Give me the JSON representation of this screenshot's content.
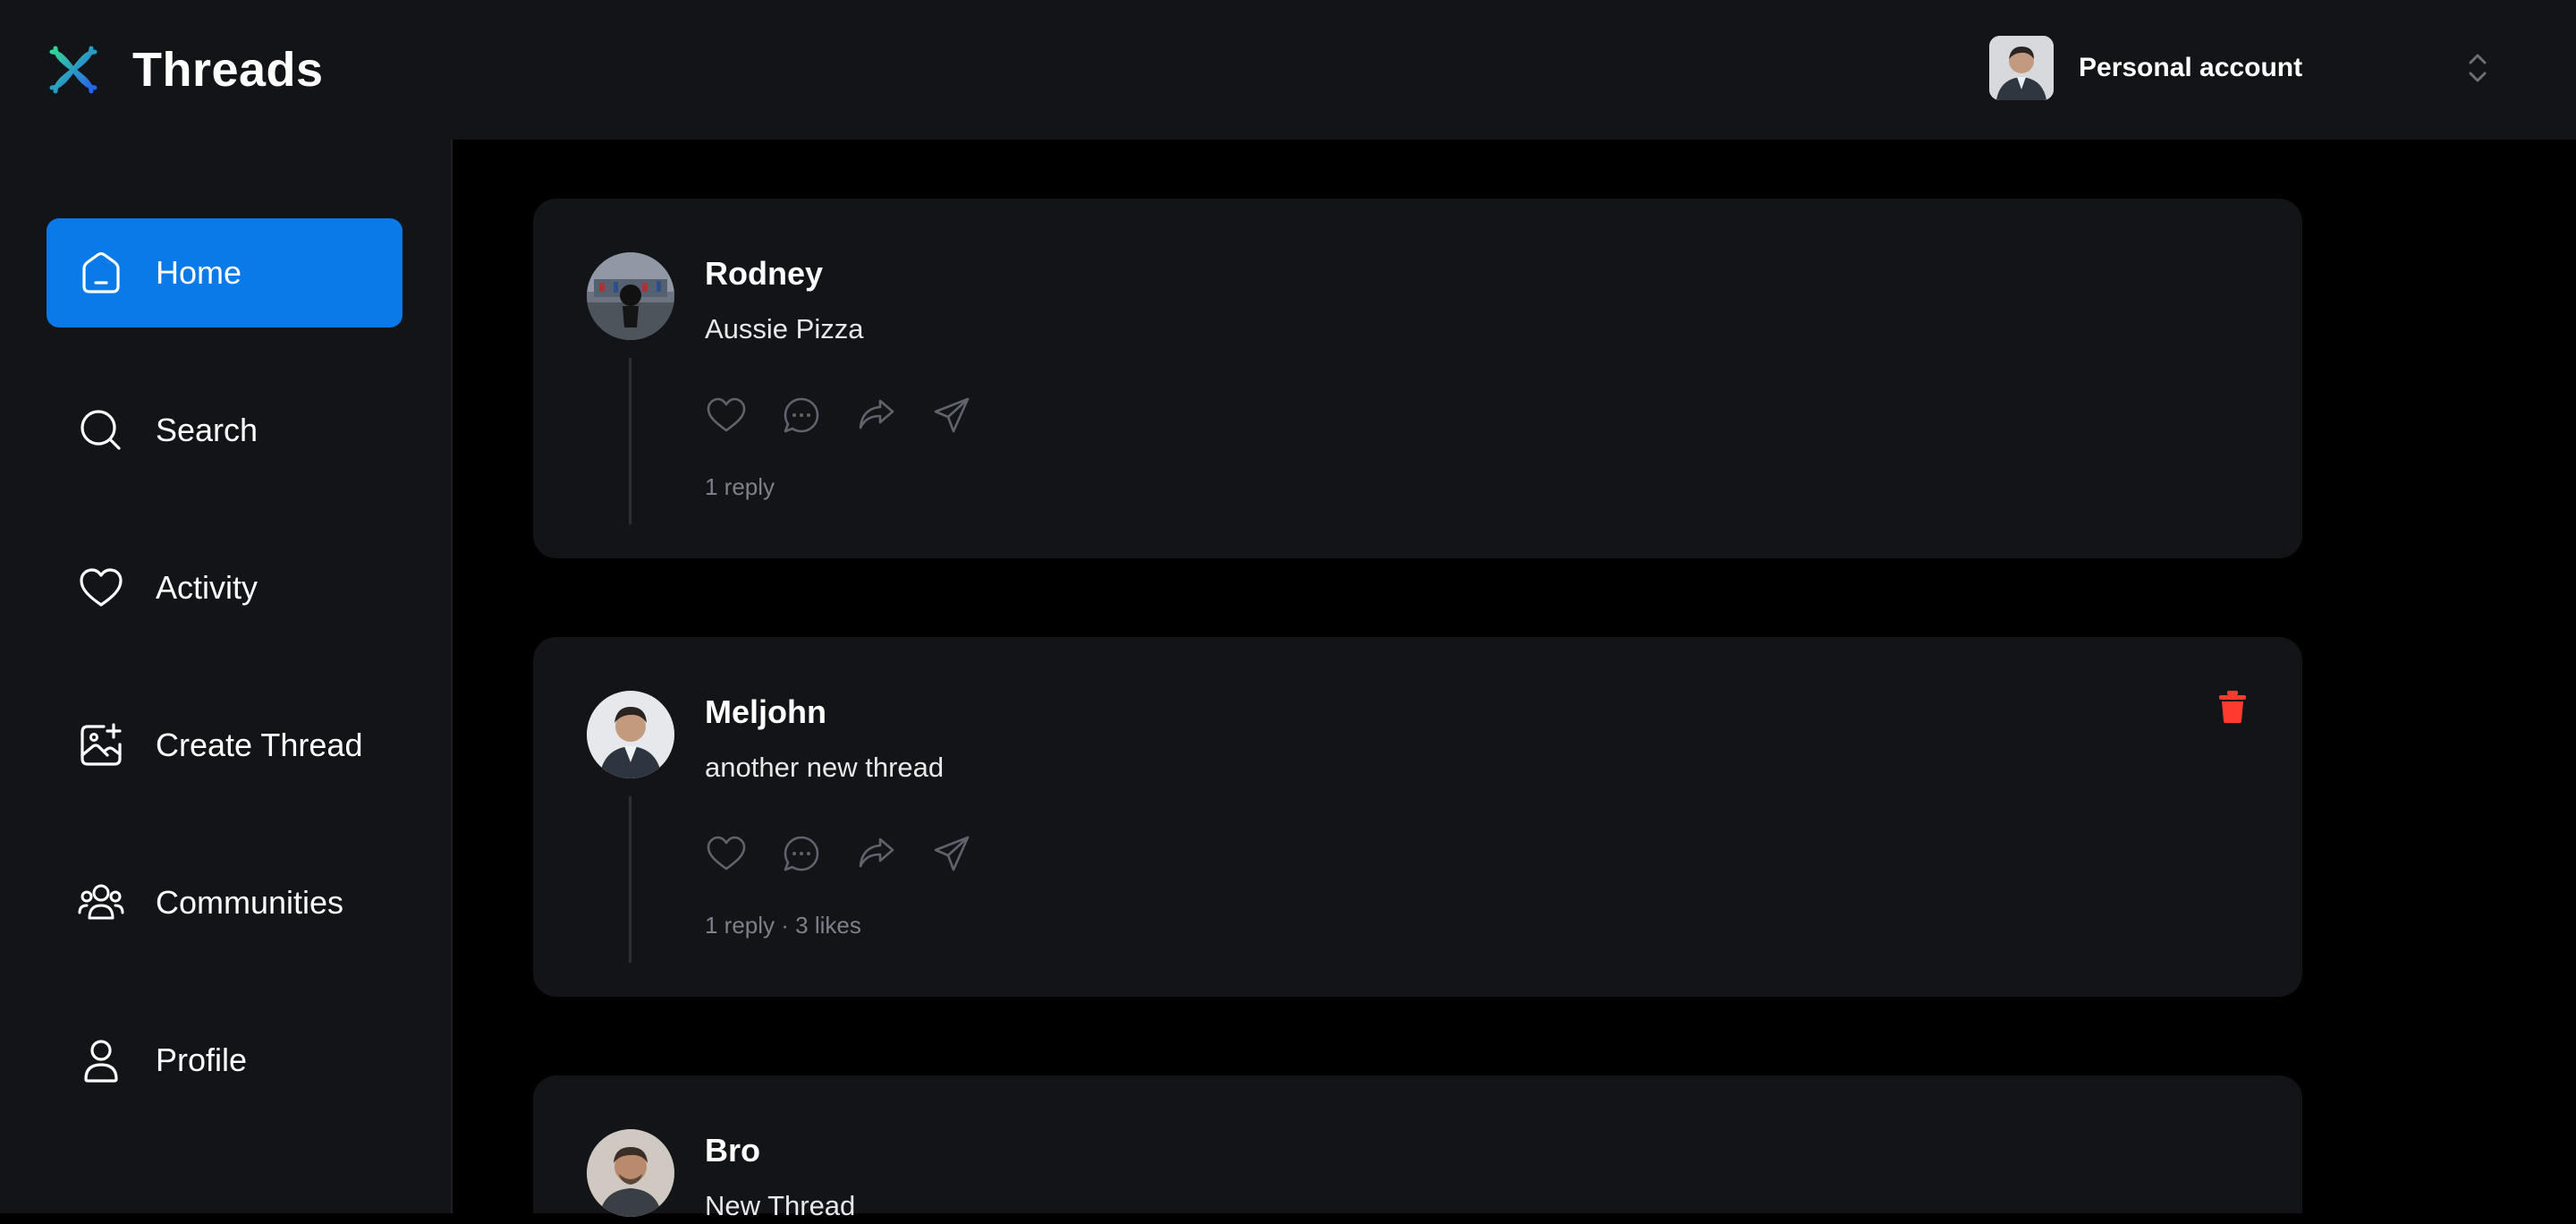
{
  "header": {
    "brand": "Threads",
    "account_label": "Personal account"
  },
  "sidebar": {
    "items": [
      {
        "label": "Home",
        "icon": "home-icon",
        "active": true
      },
      {
        "label": "Search",
        "icon": "search-icon"
      },
      {
        "label": "Activity",
        "icon": "heart-icon"
      },
      {
        "label": "Create Thread",
        "icon": "create-thread-icon"
      },
      {
        "label": "Communities",
        "icon": "communities-icon"
      },
      {
        "label": "Profile",
        "icon": "profile-icon"
      }
    ]
  },
  "threads": [
    {
      "author": "Rodney",
      "content": "Aussie Pizza",
      "meta": "1 reply",
      "can_delete": false
    },
    {
      "author": "Meljohn",
      "content": "another new thread",
      "meta": "1 reply · 3 likes",
      "can_delete": true
    },
    {
      "author": "Bro",
      "content": "New Thread",
      "meta": "",
      "can_delete": false
    }
  ],
  "colors": {
    "accent": "#0a7ae8",
    "panel": "#121417",
    "background": "#000000",
    "delete": "#ff3b30",
    "muted": "#7d818a"
  }
}
